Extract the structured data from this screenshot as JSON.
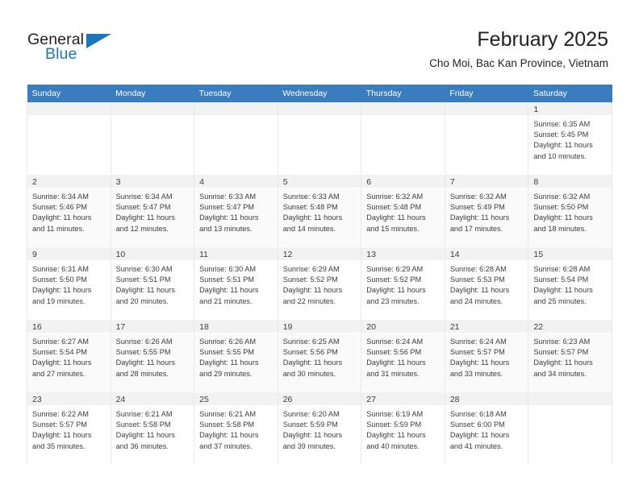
{
  "brand": {
    "name_top": "General",
    "name_bottom": "Blue",
    "accent_color": "#1b76bc"
  },
  "header": {
    "title": "February 2025",
    "subtitle": "Cho Moi, Bac Kan Province, Vietnam",
    "header_bg_color": "#3a7dbf"
  },
  "calendar": {
    "weekday_headers": [
      "Sunday",
      "Monday",
      "Tuesday",
      "Wednesday",
      "Thursday",
      "Friday",
      "Saturday"
    ],
    "weeks": [
      [
        {
          "day": "",
          "sunrise": "",
          "sunset": "",
          "daylight": ""
        },
        {
          "day": "",
          "sunrise": "",
          "sunset": "",
          "daylight": ""
        },
        {
          "day": "",
          "sunrise": "",
          "sunset": "",
          "daylight": ""
        },
        {
          "day": "",
          "sunrise": "",
          "sunset": "",
          "daylight": ""
        },
        {
          "day": "",
          "sunrise": "",
          "sunset": "",
          "daylight": ""
        },
        {
          "day": "",
          "sunrise": "",
          "sunset": "",
          "daylight": ""
        },
        {
          "day": "1",
          "sunrise": "Sunrise: 6:35 AM",
          "sunset": "Sunset: 5:45 PM",
          "daylight": "Daylight: 11 hours and 10 minutes."
        }
      ],
      [
        {
          "day": "2",
          "sunrise": "Sunrise: 6:34 AM",
          "sunset": "Sunset: 5:46 PM",
          "daylight": "Daylight: 11 hours and 11 minutes."
        },
        {
          "day": "3",
          "sunrise": "Sunrise: 6:34 AM",
          "sunset": "Sunset: 5:47 PM",
          "daylight": "Daylight: 11 hours and 12 minutes."
        },
        {
          "day": "4",
          "sunrise": "Sunrise: 6:33 AM",
          "sunset": "Sunset: 5:47 PM",
          "daylight": "Daylight: 11 hours and 13 minutes."
        },
        {
          "day": "5",
          "sunrise": "Sunrise: 6:33 AM",
          "sunset": "Sunset: 5:48 PM",
          "daylight": "Daylight: 11 hours and 14 minutes."
        },
        {
          "day": "6",
          "sunrise": "Sunrise: 6:32 AM",
          "sunset": "Sunset: 5:48 PM",
          "daylight": "Daylight: 11 hours and 15 minutes."
        },
        {
          "day": "7",
          "sunrise": "Sunrise: 6:32 AM",
          "sunset": "Sunset: 5:49 PM",
          "daylight": "Daylight: 11 hours and 17 minutes."
        },
        {
          "day": "8",
          "sunrise": "Sunrise: 6:32 AM",
          "sunset": "Sunset: 5:50 PM",
          "daylight": "Daylight: 11 hours and 18 minutes."
        }
      ],
      [
        {
          "day": "9",
          "sunrise": "Sunrise: 6:31 AM",
          "sunset": "Sunset: 5:50 PM",
          "daylight": "Daylight: 11 hours and 19 minutes."
        },
        {
          "day": "10",
          "sunrise": "Sunrise: 6:30 AM",
          "sunset": "Sunset: 5:51 PM",
          "daylight": "Daylight: 11 hours and 20 minutes."
        },
        {
          "day": "11",
          "sunrise": "Sunrise: 6:30 AM",
          "sunset": "Sunset: 5:51 PM",
          "daylight": "Daylight: 11 hours and 21 minutes."
        },
        {
          "day": "12",
          "sunrise": "Sunrise: 6:29 AM",
          "sunset": "Sunset: 5:52 PM",
          "daylight": "Daylight: 11 hours and 22 minutes."
        },
        {
          "day": "13",
          "sunrise": "Sunrise: 6:29 AM",
          "sunset": "Sunset: 5:52 PM",
          "daylight": "Daylight: 11 hours and 23 minutes."
        },
        {
          "day": "14",
          "sunrise": "Sunrise: 6:28 AM",
          "sunset": "Sunset: 5:53 PM",
          "daylight": "Daylight: 11 hours and 24 minutes."
        },
        {
          "day": "15",
          "sunrise": "Sunrise: 6:28 AM",
          "sunset": "Sunset: 5:54 PM",
          "daylight": "Daylight: 11 hours and 25 minutes."
        }
      ],
      [
        {
          "day": "16",
          "sunrise": "Sunrise: 6:27 AM",
          "sunset": "Sunset: 5:54 PM",
          "daylight": "Daylight: 11 hours and 27 minutes."
        },
        {
          "day": "17",
          "sunrise": "Sunrise: 6:26 AM",
          "sunset": "Sunset: 5:55 PM",
          "daylight": "Daylight: 11 hours and 28 minutes."
        },
        {
          "day": "18",
          "sunrise": "Sunrise: 6:26 AM",
          "sunset": "Sunset: 5:55 PM",
          "daylight": "Daylight: 11 hours and 29 minutes."
        },
        {
          "day": "19",
          "sunrise": "Sunrise: 6:25 AM",
          "sunset": "Sunset: 5:56 PM",
          "daylight": "Daylight: 11 hours and 30 minutes."
        },
        {
          "day": "20",
          "sunrise": "Sunrise: 6:24 AM",
          "sunset": "Sunset: 5:56 PM",
          "daylight": "Daylight: 11 hours and 31 minutes."
        },
        {
          "day": "21",
          "sunrise": "Sunrise: 6:24 AM",
          "sunset": "Sunset: 5:57 PM",
          "daylight": "Daylight: 11 hours and 33 minutes."
        },
        {
          "day": "22",
          "sunrise": "Sunrise: 6:23 AM",
          "sunset": "Sunset: 5:57 PM",
          "daylight": "Daylight: 11 hours and 34 minutes."
        }
      ],
      [
        {
          "day": "23",
          "sunrise": "Sunrise: 6:22 AM",
          "sunset": "Sunset: 5:57 PM",
          "daylight": "Daylight: 11 hours and 35 minutes."
        },
        {
          "day": "24",
          "sunrise": "Sunrise: 6:21 AM",
          "sunset": "Sunset: 5:58 PM",
          "daylight": "Daylight: 11 hours and 36 minutes."
        },
        {
          "day": "25",
          "sunrise": "Sunrise: 6:21 AM",
          "sunset": "Sunset: 5:58 PM",
          "daylight": "Daylight: 11 hours and 37 minutes."
        },
        {
          "day": "26",
          "sunrise": "Sunrise: 6:20 AM",
          "sunset": "Sunset: 5:59 PM",
          "daylight": "Daylight: 11 hours and 39 minutes."
        },
        {
          "day": "27",
          "sunrise": "Sunrise: 6:19 AM",
          "sunset": "Sunset: 5:59 PM",
          "daylight": "Daylight: 11 hours and 40 minutes."
        },
        {
          "day": "28",
          "sunrise": "Sunrise: 6:18 AM",
          "sunset": "Sunset: 6:00 PM",
          "daylight": "Daylight: 11 hours and 41 minutes."
        },
        {
          "day": "",
          "sunrise": "",
          "sunset": "",
          "daylight": ""
        }
      ]
    ]
  }
}
